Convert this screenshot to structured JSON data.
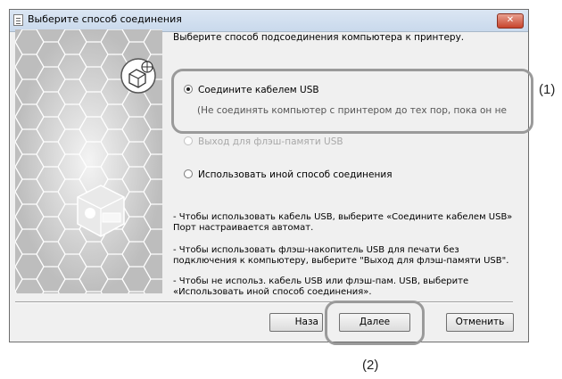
{
  "window": {
    "title": "Выберите способ соединения",
    "close_glyph": "✕"
  },
  "intro": "Выберите способ подсоединения компьютера к принтеру.",
  "options": [
    {
      "label": "Соедините кабелем USB",
      "description": "(Не соединять компьютер с принтером до тех пор, пока он не",
      "selected": true,
      "enabled": true
    },
    {
      "label": "Выход для флэш-памяти USB",
      "selected": false,
      "enabled": false
    },
    {
      "label": "Использовать иной способ соединения",
      "selected": false,
      "enabled": true
    }
  ],
  "notes": [
    [
      "- Чтобы использовать кабель USB, выберите «Соедините кабелем USB»",
      "Порт настраивается автомат."
    ],
    [
      "- Чтобы использовать флэш-накопитель USB для печати без",
      "подключения к компьютеру, выберите \"Выход для флэш-памяти USB\"."
    ],
    [
      "- Чтобы не использ. кабель USB или флэш-пам. USB, выберите",
      "«Использовать иной способ соединения»."
    ]
  ],
  "buttons": {
    "back": "Наза",
    "next": "Далее",
    "cancel": "Отменить"
  },
  "callouts": {
    "one": "(1)",
    "two": "(2)"
  },
  "icons": {
    "title": "window-app-icon",
    "close": "close-icon",
    "printer": "printer-icon",
    "network": "network-printer-icon"
  }
}
